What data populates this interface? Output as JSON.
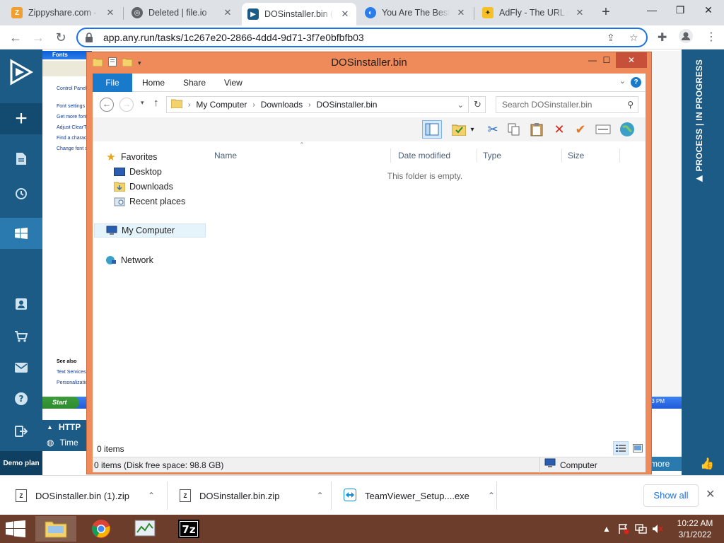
{
  "browser": {
    "tabs": [
      {
        "title": "Zippyshare.com - T",
        "favicon_color": "#f0a030",
        "favicon_glyph": "Z",
        "active": false
      },
      {
        "title": "Deleted | file.io",
        "favicon_color": "#5f6368",
        "favicon_glyph": "◎",
        "active": false
      },
      {
        "title": "DOSinstaller.bin (M",
        "favicon_color": "#1c5b85",
        "favicon_glyph": "▶",
        "active": true
      },
      {
        "title": "You Are The Best.2",
        "favicon_color": "#2b7de9",
        "favicon_glyph": "◐",
        "active": false
      },
      {
        "title": "AdFly - The URL sh",
        "favicon_color": "#f6c026",
        "favicon_glyph": "✦",
        "active": false
      }
    ],
    "url": "app.any.run/tasks/1c267e20-2866-4dd4-9d71-3f7e0bfbfb03"
  },
  "anyrun": {
    "progress_label": "PROCESS | IN PROGRESS",
    "demo_plan": "Demo plan",
    "http_label": "HTTP",
    "time_label": "Time",
    "more_label": "more"
  },
  "xp": {
    "window_title": "Fonts",
    "links": [
      "Control Panel",
      "Font settings",
      "Get more fonts",
      "Adjust ClearType",
      "Find a character",
      "Change font size"
    ],
    "see_also": "See also",
    "see_also_links": [
      "Text Services",
      "Personalization"
    ],
    "start_label": "Start",
    "clock": "3:23 PM"
  },
  "explorer": {
    "title": "DOSinstaller.bin",
    "ribbon_tabs": [
      "File",
      "Home",
      "Share",
      "View"
    ],
    "breadcrumb": [
      "My Computer",
      "Downloads",
      "DOSinstaller.bin"
    ],
    "search_placeholder": "Search DOSinstaller.bin",
    "nav": {
      "favorites": "Favorites",
      "desktop": "Desktop",
      "downloads": "Downloads",
      "recent": "Recent places",
      "my_computer": "My Computer",
      "network": "Network"
    },
    "columns": [
      "Name",
      "Date modified",
      "Type",
      "Size"
    ],
    "empty_message": "This folder is empty.",
    "item_count": "0 items",
    "details": "0 items (Disk free space: 98.8 GB)",
    "details_location": "Computer"
  },
  "downloads": {
    "items": [
      {
        "name": "DOSinstaller.bin (1).zip"
      },
      {
        "name": "DOSinstaller.bin.zip"
      },
      {
        "name": "TeamViewer_Setup....exe"
      }
    ],
    "show_all": "Show all"
  },
  "taskbar": {
    "time": "10:22 AM",
    "date": "3/1/2022"
  },
  "colors": {
    "anyrun_blue": "#1c5b85",
    "explorer_frame": "#ef8a5a",
    "ribbon_file": "#1979ca",
    "taskbar": "#6b3d2a"
  }
}
